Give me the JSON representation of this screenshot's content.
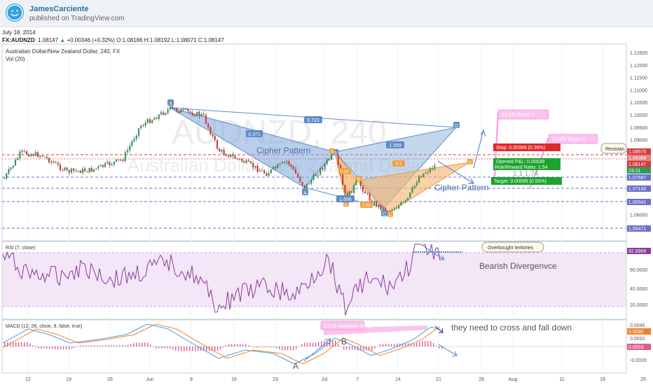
{
  "header": {
    "username": "JamesCarciente",
    "published": "published on TradingView.com",
    "avatar_icon": "smiley-face-icon"
  },
  "meta": {
    "date": "July 18, 2014",
    "symbol": "FX:AUDNZD",
    "last": "1.08147",
    "change_arrow": "▲",
    "change": "+0.00346 (+0.32%)",
    "open": "O:1.08186",
    "high": "H:1.08192",
    "low": "L:1.08071",
    "close": "C:1.08147"
  },
  "main": {
    "title": "Australian Dollar/New Zealand Dollar, 240, FX",
    "vol": "Vol (20)",
    "watermark1": "AUDNZD, 240",
    "watermark2": "Australian Dollar/New Zealand Dollar",
    "price_labels": [
      "1.12500",
      "1.12000",
      "1.11500",
      "1.11000",
      "1.10500",
      "1.10000",
      "1.09500",
      "1.09000",
      "1.08500",
      "1.08000",
      "1.07500",
      "1.07000",
      "1.06500",
      "1.06000",
      "1.05500"
    ],
    "badges": {
      "resistance_top": "1.08575",
      "level_a": "1.08369",
      "last": "1.08147",
      "count": "23:21",
      "level_b": "1.07587",
      "level_c": "1.07100",
      "level_d": "1.06541",
      "level_e": "1.05471"
    },
    "pattern_points": {
      "x": "X",
      "a": "A",
      "b": "B",
      "c": "C",
      "d": "D"
    },
    "ratios": {
      "xd": "0.723",
      "xb": "0.371",
      "bd": "1.559",
      "ac": "1.696"
    },
    "pattern_label_1": "Cipher Pattern",
    "pattern_label_2": "Cipher Pattern",
    "orange_ratios": {
      "r1": "0.32",
      "r2": "0.?",
      "r3": "1.59"
    },
    "orange_points": {
      "x": "X",
      "a": "A",
      "b": "B",
      "c": "C",
      "d": "D"
    },
    "stop": "Stop: 0.00389 (0.36%)",
    "opened_pl": "Opened P&L: 0.00039",
    "risk_reward": "Risk/Reward Ratio: 1.54",
    "target": "Target: 0.00599 (0.55%)",
    "ratio_text": "1:1 1.74",
    "target1": "31.8% Target 1",
    "target2": "61.8% Target II",
    "resistance": "Resistan"
  },
  "rsi": {
    "title": "RSI (7, close)",
    "labels": [
      "80.0000",
      "60.0000",
      "40.0000",
      "20.0000"
    ],
    "badge": "82.8989",
    "bubble": "Overbought teritories",
    "note": "Bearish Divergenvce"
  },
  "macd": {
    "title": "MACD (12, 26, close, 9, false, true)",
    "labels": [
      "0.0040",
      "0.0020",
      "0.0000",
      "-0.0020"
    ],
    "badge1": "0.0030",
    "badge2": "0.0003",
    "label_a": "A",
    "label_b": "B",
    "extension": "1.618 extension of AB",
    "note": "they need to cross and fall down"
  },
  "xaxis": [
    "12",
    "19",
    "26",
    "Jun",
    "9",
    "16",
    "23",
    "Jul",
    "7",
    "14",
    "21",
    "28",
    "Aug",
    "11",
    "18",
    "25"
  ],
  "colors": {
    "up": "#2c9b5d",
    "down": "#d23b3b",
    "blue_pattern": "#7ea6d8",
    "orange_pattern": "#f5b36b",
    "target_pink": "#f9a7e7",
    "stop_red": "#e02a2a",
    "green_box": "#1da32d",
    "rsi_line": "#8b3a9a",
    "rsi_band": "#f3e6f7",
    "macd_blue": "#3fa0e6",
    "macd_orange": "#f0812c",
    "hist": "#e05c8f"
  }
}
